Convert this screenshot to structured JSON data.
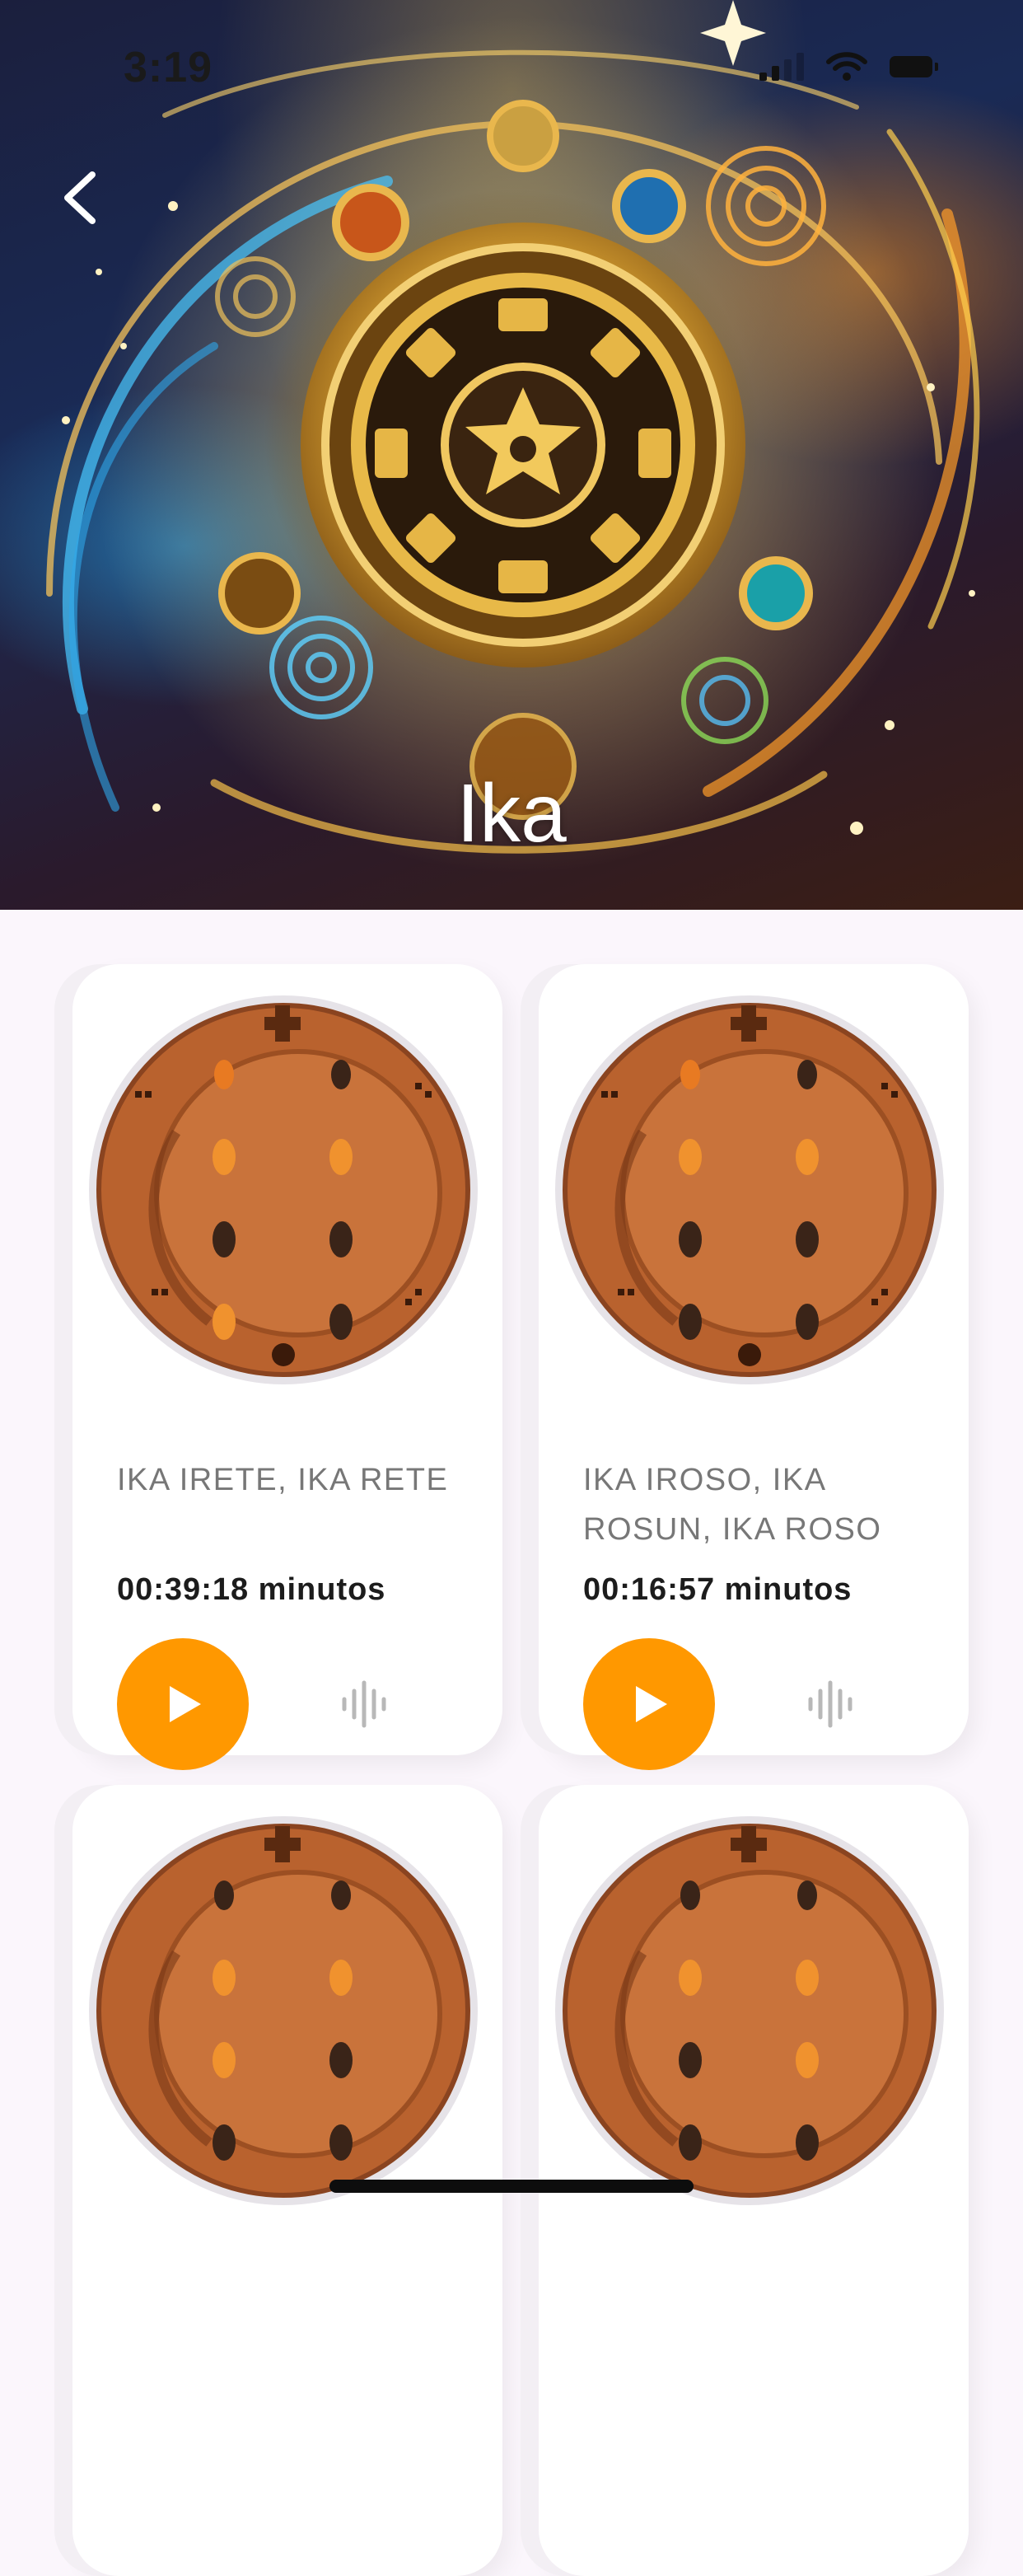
{
  "status_bar": {
    "time": "3:19"
  },
  "header": {
    "title": "Ika",
    "back_icon": "chevron-left-icon"
  },
  "cards": [
    {
      "title": "IKA IRETE, IKA RETE",
      "duration": "00:39:18 minutos",
      "play_icon": "play-icon",
      "audio_icon": "audio-wave-icon"
    },
    {
      "title": "IKA IROSO, IKA ROSUN, IKA ROSO",
      "duration": "00:16:57 minutos",
      "play_icon": "play-icon",
      "audio_icon": "audio-wave-icon"
    },
    {
      "title": "",
      "duration": ""
    },
    {
      "title": "",
      "duration": ""
    }
  ],
  "colors": {
    "accent": "#ff9800",
    "background": "#fbf6fc",
    "card": "#ffffff"
  }
}
